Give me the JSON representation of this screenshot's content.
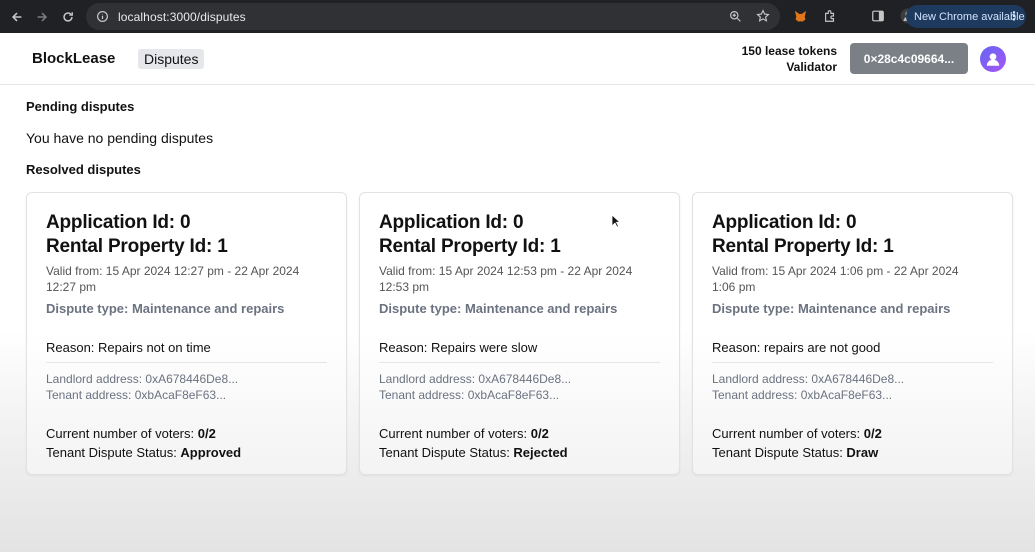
{
  "browser": {
    "url": "localhost:3000/disputes",
    "update_label": "New Chrome available"
  },
  "header": {
    "brand": "BlockLease",
    "nav_disputes": "Disputes",
    "tokens": "150 lease tokens",
    "role": "Validator",
    "wallet": "0×28c4c09664..."
  },
  "pending": {
    "title": "Pending disputes",
    "empty_message": "You have no pending disputes"
  },
  "resolved": {
    "title": "Resolved disputes",
    "labels": {
      "voters": "Current number of voters: ",
      "status": "Tenant Dispute Status: "
    },
    "cards": [
      {
        "application": "Application Id: 0",
        "property": "Rental Property Id: 1",
        "valid": "Valid from: 15 Apr 2024 12:27 pm - 22 Apr 2024 12:27 pm",
        "dispute_type": "Dispute type: Maintenance and repairs",
        "reason": "Reason: Repairs not on time",
        "landlord": "Landlord address: 0xA678446De8...",
        "tenant": "Tenant address: 0xbAcaF8eF63...",
        "voters": "0/2",
        "status": "Approved"
      },
      {
        "application": "Application Id: 0",
        "property": "Rental Property Id: 1",
        "valid": "Valid from: 15 Apr 2024 12:53 pm - 22 Apr 2024 12:53 pm",
        "dispute_type": "Dispute type: Maintenance and repairs",
        "reason": "Reason: Repairs were slow",
        "landlord": "Landlord address: 0xA678446De8...",
        "tenant": "Tenant address: 0xbAcaF8eF63...",
        "voters": "0/2",
        "status": "Rejected"
      },
      {
        "application": "Application Id: 0",
        "property": "Rental Property Id: 1",
        "valid": "Valid from: 15 Apr 2024 1:06 pm - 22 Apr 2024 1:06 pm",
        "dispute_type": "Dispute type: Maintenance and repairs",
        "reason": "Reason: repairs are not good",
        "landlord": "Landlord address: 0xA678446De8...",
        "tenant": "Tenant address: 0xbAcaF8eF63...",
        "voters": "0/2",
        "status": "Draw"
      }
    ]
  }
}
